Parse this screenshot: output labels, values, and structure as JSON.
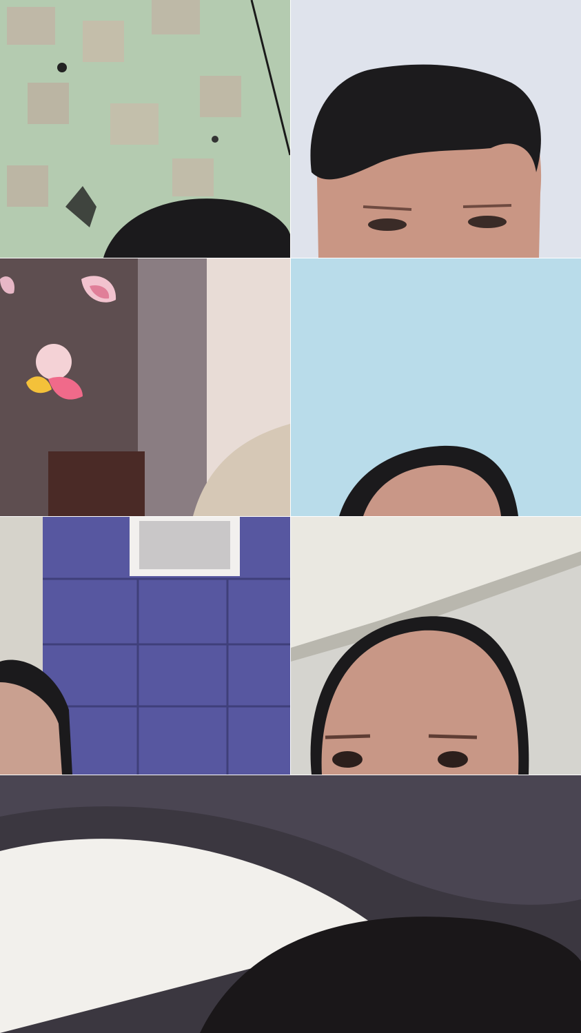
{
  "app": {
    "view": "video-call-grid"
  },
  "participants": [
    {
      "tile": 1,
      "scene": "patterned-green-wall-with-top-of-head"
    },
    {
      "tile": 2,
      "scene": "man-face-upper-half-light-wall"
    },
    {
      "tile": 3,
      "scene": "blurry-room-with-face-filter-ears"
    },
    {
      "tile": 4,
      "scene": "light-blue-wall-with-top-of-head"
    },
    {
      "tile": 5,
      "scene": "purple-padded-wall-with-partial-head"
    },
    {
      "tile": 6,
      "scene": "person-face-upper-half-ceiling"
    },
    {
      "tile": 7,
      "scene": "closeup-head-and-dark-ceiling"
    }
  ],
  "colors": {
    "divider": "#ffffff",
    "wall_green": "#a9c4a4",
    "wall_light": "#dfe3ec",
    "wall_blue": "#b8dcea",
    "wall_purple": "#5a5aa0",
    "hair": "#1b1a1c"
  }
}
